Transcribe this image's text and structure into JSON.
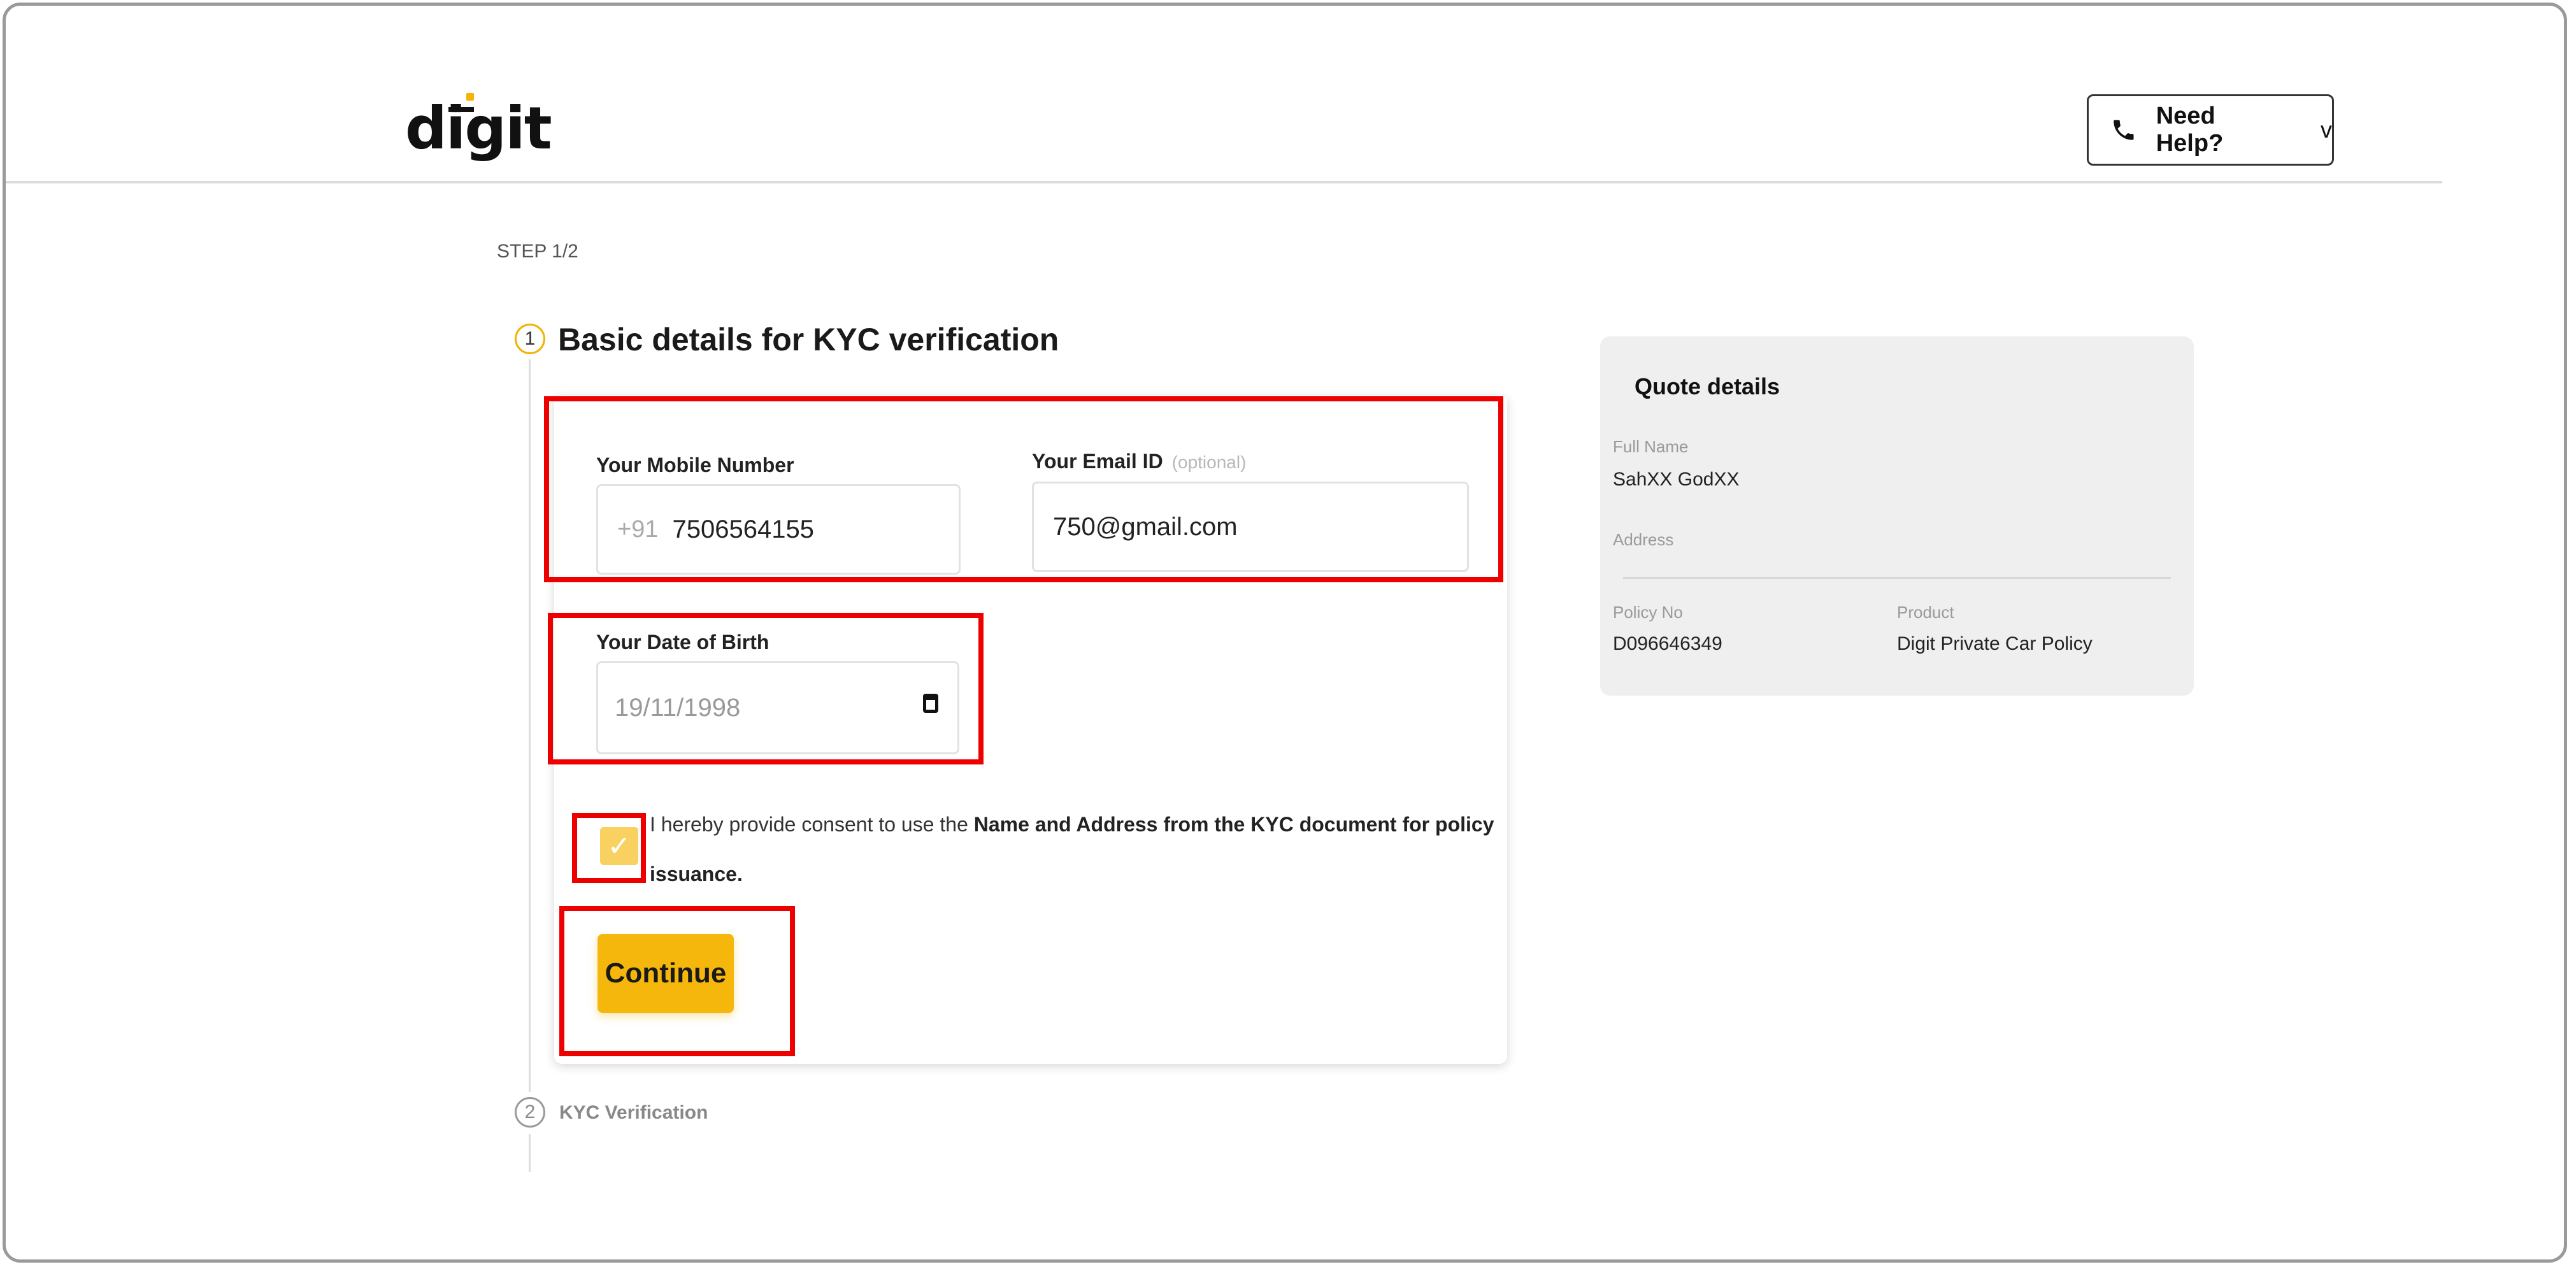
{
  "header": {
    "logo_text": "digit",
    "help_label": "Need Help?",
    "help_icon": "phone-icon",
    "help_chevron": "v"
  },
  "stepper": {
    "step_label": "STEP 1/2",
    "steps": [
      {
        "number": "1",
        "title": "Basic details for KYC verification",
        "status": "active"
      },
      {
        "number": "2",
        "title": "KYC Verification",
        "status": "pending"
      }
    ]
  },
  "form": {
    "mobile": {
      "label": "Your Mobile Number",
      "prefix": "+91",
      "value": "7506564155"
    },
    "email": {
      "label": "Your Email ID",
      "optional": "(optional)",
      "value": "750@gmail.com"
    },
    "dob": {
      "label": "Your Date of Birth",
      "value": "19/11/1998",
      "icon": "calendar-icon"
    },
    "consent": {
      "checked": true,
      "text_prefix": "I hereby provide consent to use the",
      "text_bold_1": "Name and Address from the KYC document for policy",
      "text_bold_2": "issuance."
    },
    "continue_label": "Continue"
  },
  "quote": {
    "title": "Quote details",
    "full_name_label": "Full Name",
    "full_name": "SahXX GodXX",
    "address_label": "Address",
    "policy_no_label": "Policy No",
    "policy_no": "D096646349",
    "product_label": "Product",
    "product": "Digit Private Car Policy"
  },
  "colors": {
    "accent": "#f6b70c",
    "annotation": "#ee0000",
    "panel_bg": "#efefef"
  }
}
